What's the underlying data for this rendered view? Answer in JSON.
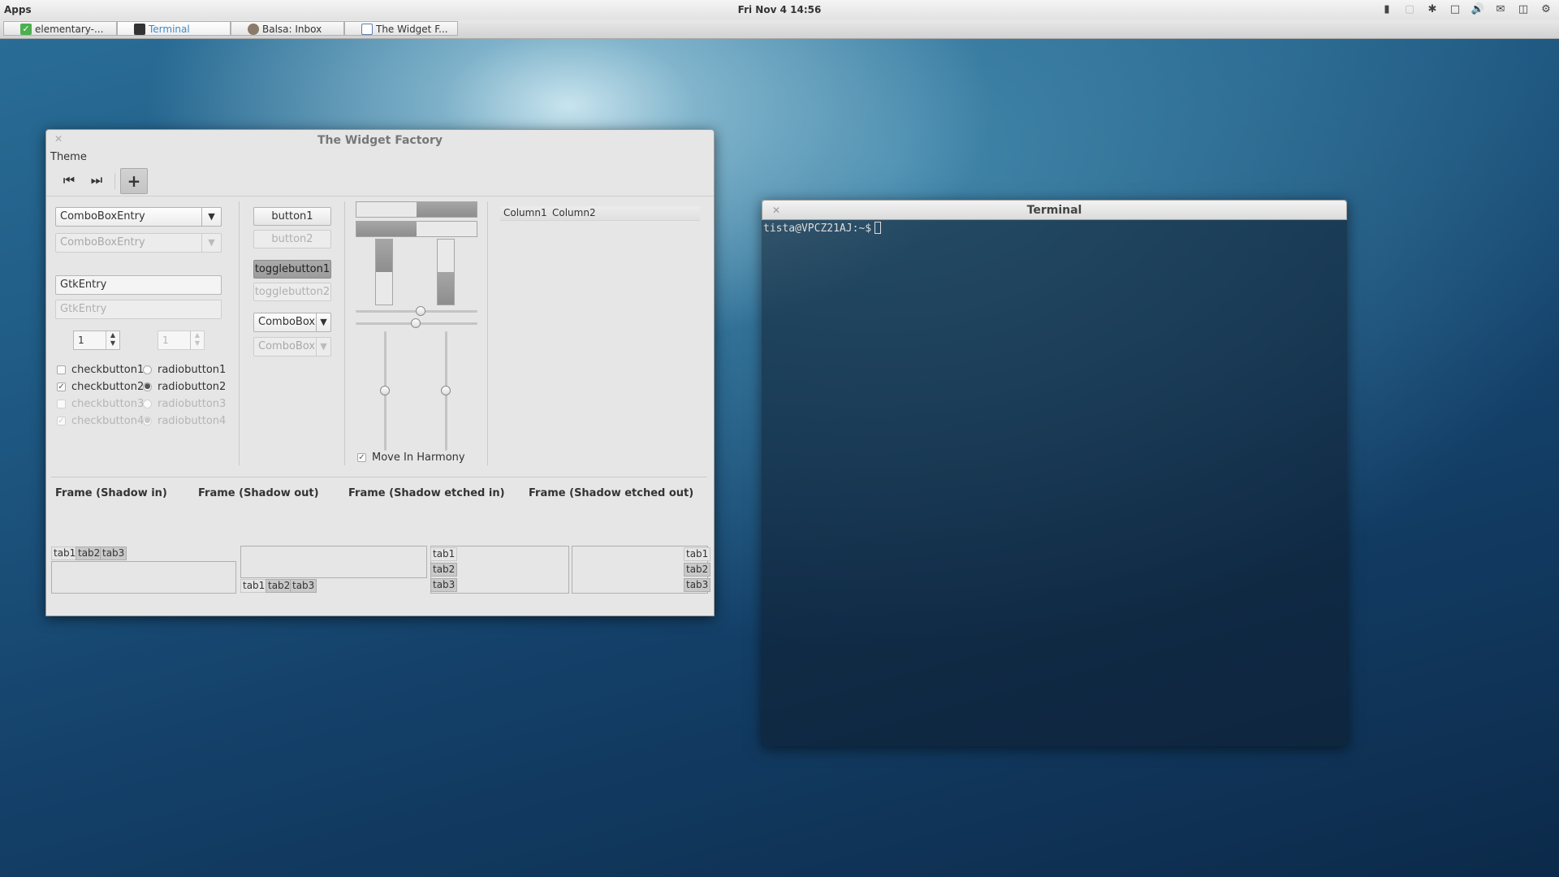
{
  "panel": {
    "apps_label": "Apps",
    "clock": "Fri Nov  4 14:56",
    "tray_icons": [
      "signal-icon",
      "network-icon",
      "bluetooth-icon",
      "window-icon",
      "volume-icon",
      "mail-icon",
      "battery-icon",
      "settings-gear-icon"
    ]
  },
  "taskbar": {
    "items": [
      {
        "label": "elementary-...",
        "icon": "check-icon",
        "color": "#4caf50"
      },
      {
        "label": "Terminal",
        "icon": "terminal-icon",
        "color": "#333333",
        "active": true
      },
      {
        "label": "Balsa: Inbox",
        "icon": "balsa-icon",
        "color": "#7a6a5a"
      },
      {
        "label": "The Widget F...",
        "icon": "window-icon",
        "color": "#5a7fb0"
      }
    ]
  },
  "widget_factory": {
    "title": "The Widget Factory",
    "menu": "Theme",
    "combo_entry": "ComboBoxEntry",
    "combo_entry_disabled": "ComboBoxEntry",
    "entry": "GtkEntry",
    "entry_disabled": "GtkEntry",
    "spin1": "1",
    "spin2": "1",
    "checks": [
      "checkbutton1",
      "checkbutton2",
      "checkbutton3",
      "checkbutton4"
    ],
    "radios": [
      "radiobutton1",
      "radiobutton2",
      "radiobutton3",
      "radiobutton4"
    ],
    "button1": "button1",
    "button2": "button2",
    "toggle1": "togglebutton1",
    "toggle2": "togglebutton2",
    "combo1": "ComboBox",
    "combo2": "ComboBox",
    "harmony": "Move In Harmony",
    "tree_columns": [
      "Column1",
      "Column2"
    ],
    "frames": [
      "Frame (Shadow in)",
      "Frame (Shadow out)",
      "Frame (Shadow etched in)",
      "Frame (Shadow etched out)"
    ],
    "tabs": [
      "tab1",
      "tab2",
      "tab3"
    ],
    "progress_horizontal": [
      0.5,
      0.5
    ],
    "progress_vertical": [
      0.5,
      0.5
    ],
    "check_states": [
      false,
      true,
      false,
      true
    ],
    "radio_selected": 2
  },
  "terminal": {
    "title": "Terminal",
    "prompt": "tista@VPCZ21AJ:~$"
  }
}
